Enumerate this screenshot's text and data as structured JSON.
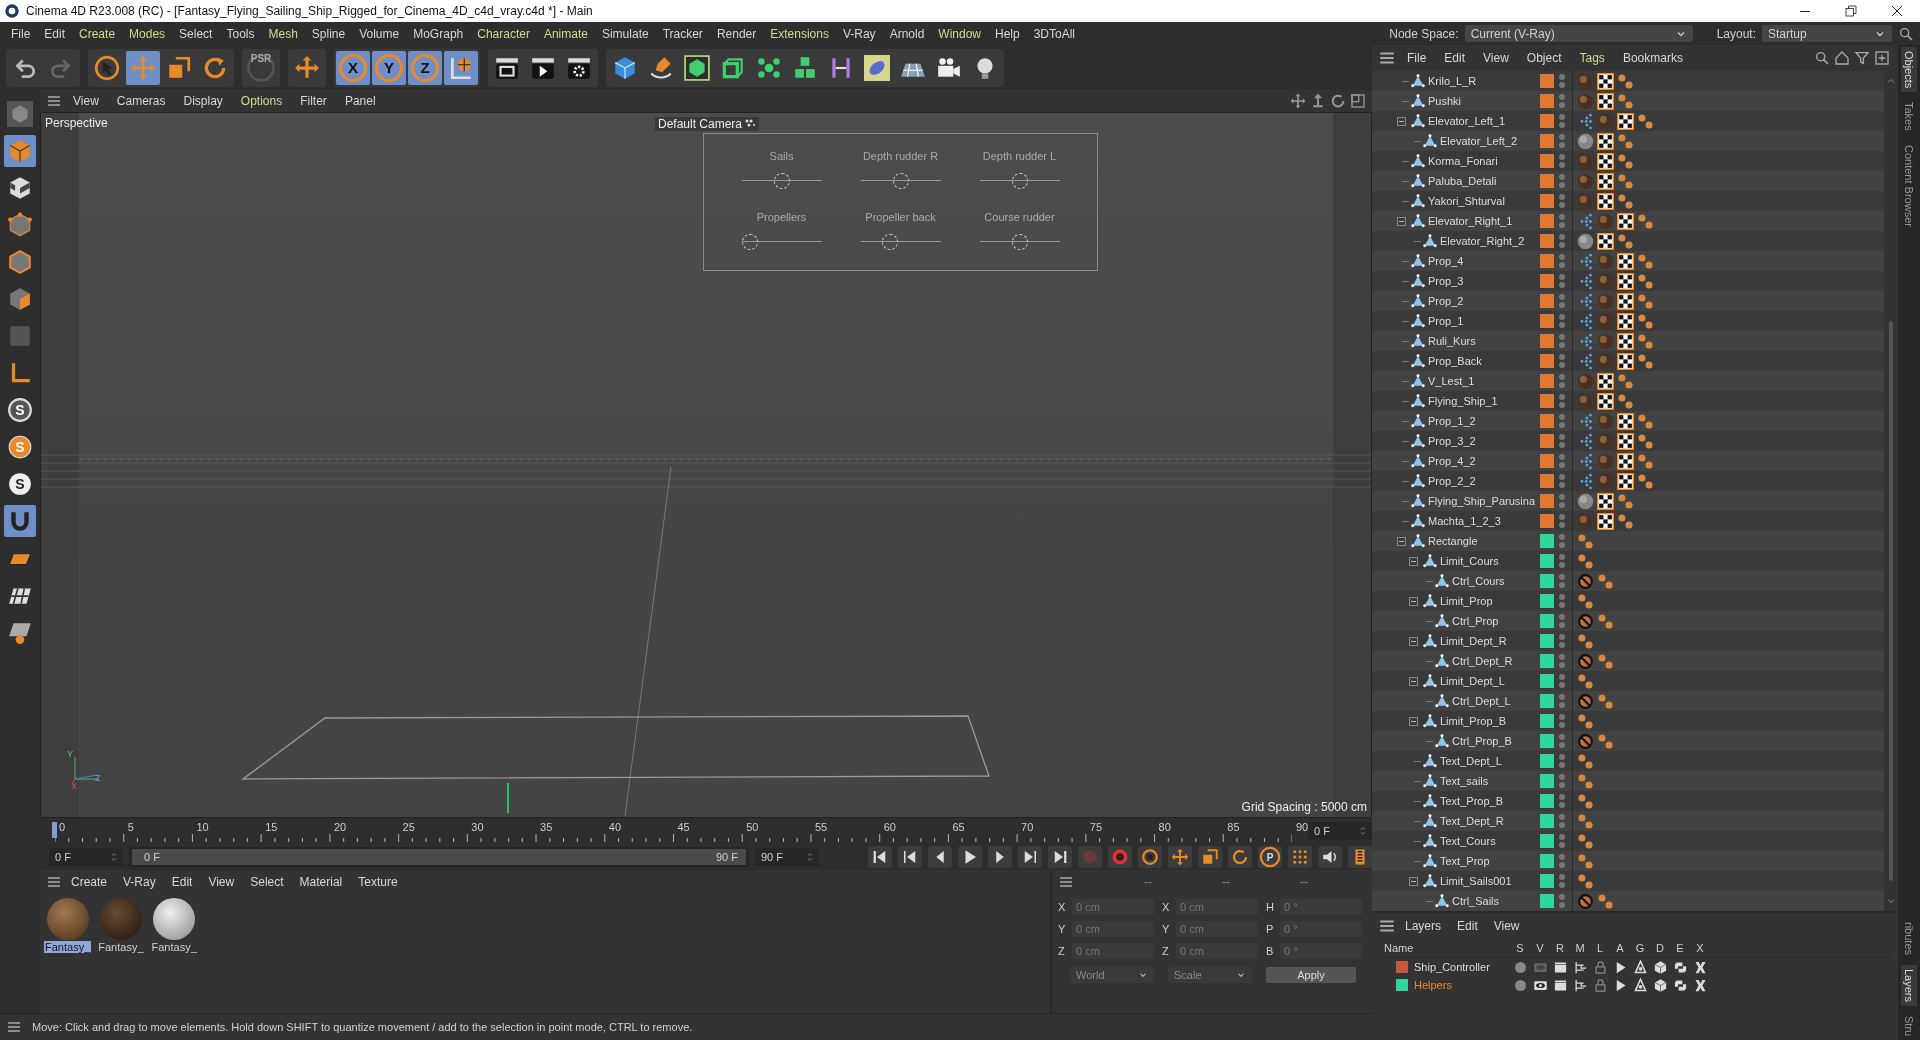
{
  "window": {
    "title": "Cinema 4D R23.008 (RC) - [Fantasy_Flying_Sailing_Ship_Rigged_for_Cinema_4D_c4d_vray.c4d *] - Main"
  },
  "menu_bar": [
    {
      "label": "File",
      "highlighted": false
    },
    {
      "label": "Edit",
      "highlighted": false
    },
    {
      "label": "Create",
      "highlighted": true
    },
    {
      "label": "Modes",
      "highlighted": true
    },
    {
      "label": "Select",
      "highlighted": false
    },
    {
      "label": "Tools",
      "highlighted": false
    },
    {
      "label": "Mesh",
      "highlighted": true
    },
    {
      "label": "Spline",
      "highlighted": false
    },
    {
      "label": "Volume",
      "highlighted": false
    },
    {
      "label": "MoGraph",
      "highlighted": false
    },
    {
      "label": "Character",
      "highlighted": true
    },
    {
      "label": "Animate",
      "highlighted": true
    },
    {
      "label": "Simulate",
      "highlighted": false
    },
    {
      "label": "Tracker",
      "highlighted": false
    },
    {
      "label": "Render",
      "highlighted": false
    },
    {
      "label": "Extensions",
      "highlighted": true
    },
    {
      "label": "V-Ray",
      "highlighted": false
    },
    {
      "label": "Arnold",
      "highlighted": false
    },
    {
      "label": "Window",
      "highlighted": true
    },
    {
      "label": "Help",
      "highlighted": false
    },
    {
      "label": "3DToAll",
      "highlighted": false
    }
  ],
  "node_space": {
    "label": "Node Space:",
    "value": "Current (V-Ray)"
  },
  "layout": {
    "label": "Layout:",
    "value": "Startup"
  },
  "toolbar": [
    {
      "items": [
        {
          "kind": "undo",
          "selected": false
        },
        {
          "kind": "redo",
          "selected": false
        }
      ]
    },
    {
      "items": [
        {
          "kind": "select",
          "selected": false
        },
        {
          "kind": "move",
          "selected": true
        },
        {
          "kind": "scale",
          "selected": false
        },
        {
          "kind": "rotate",
          "selected": false
        }
      ]
    },
    {
      "items": [
        {
          "kind": "psr",
          "label": "PSR",
          "selected": false
        }
      ]
    },
    {
      "items": [
        {
          "kind": "addmove",
          "selected": false
        }
      ]
    },
    {
      "items": [
        {
          "kind": "axis",
          "label": "X",
          "selected": true
        },
        {
          "kind": "axis",
          "label": "Y",
          "selected": true
        },
        {
          "kind": "axis",
          "label": "Z",
          "selected": true
        },
        {
          "kind": "world",
          "selected": true
        }
      ]
    },
    {
      "items": [
        {
          "kind": "renderview",
          "selected": false
        },
        {
          "kind": "render",
          "selected": false
        },
        {
          "kind": "rendersettings",
          "selected": false
        }
      ]
    },
    {
      "items": [
        {
          "kind": "cube",
          "selected": false
        },
        {
          "kind": "pen",
          "selected": false
        },
        {
          "kind": "subdiv",
          "selected": false
        },
        {
          "kind": "extrude",
          "selected": false
        },
        {
          "kind": "cloner",
          "selected": false
        },
        {
          "kind": "cubes",
          "selected": false
        },
        {
          "kind": "deformer",
          "selected": false
        },
        {
          "kind": "field",
          "selected": false
        },
        {
          "kind": "floor",
          "selected": false
        },
        {
          "kind": "camera",
          "selected": false
        },
        {
          "kind": "light",
          "selected": false
        }
      ]
    }
  ],
  "tool_palette": [
    {
      "kind": "editable",
      "selected": false
    },
    {
      "kind": "model",
      "selected": true
    },
    {
      "kind": "texture",
      "selected": false
    },
    {
      "kind": "points",
      "selected": false
    },
    {
      "kind": "edges",
      "selected": false
    },
    {
      "kind": "polygons",
      "selected": false
    },
    {
      "kind": "solo",
      "selected": false
    },
    {
      "kind": "axisl",
      "selected": false
    },
    {
      "kind": "snap",
      "label": "S",
      "selected": false
    },
    {
      "kind": "snapo",
      "label": "S",
      "selected": false
    },
    {
      "kind": "snapw",
      "label": "S",
      "selected": false
    },
    {
      "kind": "tweak",
      "selected": true
    },
    {
      "kind": "workplane",
      "selected": false
    },
    {
      "kind": "gridplane",
      "selected": false
    },
    {
      "kind": "lockplane",
      "selected": false
    }
  ],
  "viewport": {
    "menu": [
      {
        "label": "View",
        "highlighted": false
      },
      {
        "label": "Cameras",
        "highlighted": false
      },
      {
        "label": "Display",
        "highlighted": false
      },
      {
        "label": "Options",
        "highlighted": true
      },
      {
        "label": "Filter",
        "highlighted": false
      },
      {
        "label": "Panel",
        "highlighted": false
      }
    ],
    "name": "Perspective",
    "camera": "Default Camera",
    "controls": [
      {
        "label": "Sails",
        "level": 0.5
      },
      {
        "label": "Depth rudder R",
        "level": 0.5
      },
      {
        "label": "Depth rudder L",
        "level": 0.5
      },
      {
        "label": "Propellers",
        "level": 0
      },
      {
        "label": "Propeller back",
        "level": 0.33
      },
      {
        "label": "Course rudder",
        "level": 0.5
      }
    ],
    "axis_labels": [
      "Y",
      "X",
      "Z"
    ],
    "grid_spacing": "Grid Spacing : 5000 cm"
  },
  "timeline": {
    "ticks": [
      "0",
      "5",
      "10",
      "15",
      "20",
      "25",
      "30",
      "35",
      "40",
      "45",
      "50",
      "55",
      "60",
      "65",
      "70",
      "75",
      "80",
      "85",
      "90"
    ],
    "level": 0,
    "current": "0 F",
    "start": "0 F",
    "range": {
      "start": "0 F",
      "end": "90 F",
      "level": 1
    },
    "end": "90 F",
    "transport": [
      {
        "kind": "first"
      },
      {
        "kind": "prevkey"
      },
      {
        "kind": "prevframe"
      },
      {
        "kind": "play"
      },
      {
        "kind": "nextframe"
      },
      {
        "kind": "nextkey"
      },
      {
        "kind": "last"
      },
      {
        "kind": "recoff"
      },
      {
        "kind": "autokey"
      },
      {
        "kind": "key"
      },
      {
        "kind": "kmove"
      },
      {
        "kind": "kscale"
      },
      {
        "kind": "krot"
      },
      {
        "kind": "kparam",
        "label": "P"
      },
      {
        "kind": "kgrid"
      },
      {
        "kind": "sound"
      },
      {
        "kind": "script"
      }
    ]
  },
  "materials": {
    "menu": [
      "Create",
      "V-Ray",
      "Edit",
      "View",
      "Select",
      "Material",
      "Texture"
    ],
    "items": [
      {
        "name": "Fantasy_",
        "kind": "wood",
        "selected": true
      },
      {
        "name": "Fantasy_",
        "kind": "dark",
        "selected": false
      },
      {
        "name": "Fantasy_",
        "kind": "white",
        "selected": false
      }
    ]
  },
  "coordinates": {
    "headers": [
      "--",
      "--",
      "--"
    ],
    "rows": [
      {
        "axis": "X",
        "position": "0 cm",
        "size_axis": "X",
        "size": "0 cm",
        "rot_axis": "H",
        "rotation": "0 °"
      },
      {
        "axis": "Y",
        "position": "0 cm",
        "size_axis": "Y",
        "size": "0 cm",
        "rot_axis": "P",
        "rotation": "0 °"
      },
      {
        "axis": "Z",
        "position": "0 cm",
        "size_axis": "Z",
        "size": "0 cm",
        "rot_axis": "B",
        "rotation": "0 °"
      }
    ],
    "mode": "World",
    "size_mode": "Scale",
    "apply": "Apply"
  },
  "status_bar": "Move: Click and drag to move elements. Hold down SHIFT to quantize movement / add to the selection in point mode, CTRL to remove.",
  "object_manager": {
    "menu": [
      {
        "label": "File",
        "highlighted": false
      },
      {
        "label": "Edit",
        "highlighted": false
      },
      {
        "label": "View",
        "highlighted": false
      },
      {
        "label": "Object",
        "highlighted": false
      },
      {
        "label": "Tags",
        "highlighted": true
      },
      {
        "label": "Bookmarks",
        "highlighted": false
      }
    ],
    "objects": [
      {
        "name": "Krilo_L_R",
        "color": "#e07a33",
        "tags": [
          {
            "kind": "mdark"
          },
          {
            "kind": "uvw"
          },
          {
            "kind": "sel"
          }
        ]
      },
      {
        "name": "Pushki",
        "color": "#e07a33",
        "tags": [
          {
            "kind": "mdark"
          },
          {
            "kind": "uvw"
          },
          {
            "kind": "sel"
          }
        ]
      },
      {
        "name": "Elevator_Left_1",
        "color": "#e07a33",
        "tags": [
          {
            "kind": "vmap"
          },
          {
            "kind": "mdark"
          },
          {
            "kind": "uvw"
          },
          {
            "kind": "sel"
          }
        ],
        "expanded": true,
        "children": [
          {
            "name": "Elevator_Left_2",
            "color": "#e07a33",
            "tags": [
              {
                "kind": "mgrey"
              },
              {
                "kind": "uvw"
              },
              {
                "kind": "sel"
              }
            ]
          }
        ]
      },
      {
        "name": "Korma_Fonari",
        "color": "#e07a33",
        "tags": [
          {
            "kind": "mdark"
          },
          {
            "kind": "uvw"
          },
          {
            "kind": "sel"
          }
        ]
      },
      {
        "name": "Paluba_Detali",
        "color": "#e07a33",
        "tags": [
          {
            "kind": "mdark"
          },
          {
            "kind": "uvw"
          },
          {
            "kind": "sel"
          }
        ]
      },
      {
        "name": "Yakori_Shturval",
        "color": "#e07a33",
        "tags": [
          {
            "kind": "mdark"
          },
          {
            "kind": "uvw"
          },
          {
            "kind": "sel"
          }
        ]
      },
      {
        "name": "Elevator_Right_1",
        "color": "#e07a33",
        "tags": [
          {
            "kind": "vmap"
          },
          {
            "kind": "mdark"
          },
          {
            "kind": "uvw"
          },
          {
            "kind": "sel"
          }
        ],
        "expanded": true,
        "children": [
          {
            "name": "Elevator_Right_2",
            "color": "#e07a33",
            "tags": [
              {
                "kind": "mgrey"
              },
              {
                "kind": "uvw"
              },
              {
                "kind": "sel"
              }
            ]
          }
        ]
      },
      {
        "name": "Prop_4",
        "color": "#e07a33",
        "tags": [
          {
            "kind": "vmap"
          },
          {
            "kind": "mdark"
          },
          {
            "kind": "uvw"
          },
          {
            "kind": "sel"
          }
        ]
      },
      {
        "name": "Prop_3",
        "color": "#e07a33",
        "tags": [
          {
            "kind": "vmap"
          },
          {
            "kind": "mdark"
          },
          {
            "kind": "uvw"
          },
          {
            "kind": "sel"
          }
        ]
      },
      {
        "name": "Prop_2",
        "color": "#e07a33",
        "tags": [
          {
            "kind": "vmap"
          },
          {
            "kind": "mdark"
          },
          {
            "kind": "uvw"
          },
          {
            "kind": "sel"
          }
        ]
      },
      {
        "name": "Prop_1",
        "color": "#e07a33",
        "tags": [
          {
            "kind": "vmap"
          },
          {
            "kind": "mdark"
          },
          {
            "kind": "uvw"
          },
          {
            "kind": "sel"
          }
        ]
      },
      {
        "name": "Ruli_Kurs",
        "color": "#e07a33",
        "tags": [
          {
            "kind": "vmap"
          },
          {
            "kind": "mdark"
          },
          {
            "kind": "uvw"
          },
          {
            "kind": "sel"
          }
        ]
      },
      {
        "name": "Prop_Back",
        "color": "#e07a33",
        "tags": [
          {
            "kind": "vmap"
          },
          {
            "kind": "mdark"
          },
          {
            "kind": "uvw"
          },
          {
            "kind": "sel"
          }
        ]
      },
      {
        "name": "V_Lest_1",
        "color": "#e07a33",
        "tags": [
          {
            "kind": "mdark"
          },
          {
            "kind": "uvw"
          },
          {
            "kind": "sel"
          }
        ]
      },
      {
        "name": "Flying_Ship_1",
        "color": "#e07a33",
        "tags": [
          {
            "kind": "mdark"
          },
          {
            "kind": "uvw"
          },
          {
            "kind": "sel"
          }
        ]
      },
      {
        "name": "Prop_1_2",
        "color": "#e07a33",
        "tags": [
          {
            "kind": "vmap"
          },
          {
            "kind": "mdark"
          },
          {
            "kind": "uvw"
          },
          {
            "kind": "sel"
          }
        ]
      },
      {
        "name": "Prop_3_2",
        "color": "#e07a33",
        "tags": [
          {
            "kind": "vmap"
          },
          {
            "kind": "mdark"
          },
          {
            "kind": "uvw"
          },
          {
            "kind": "sel"
          }
        ]
      },
      {
        "name": "Prop_4_2",
        "color": "#e07a33",
        "tags": [
          {
            "kind": "vmap"
          },
          {
            "kind": "mdark"
          },
          {
            "kind": "uvw"
          },
          {
            "kind": "sel"
          }
        ]
      },
      {
        "name": "Prop_2_2",
        "color": "#e07a33",
        "tags": [
          {
            "kind": "vmap"
          },
          {
            "kind": "mdark"
          },
          {
            "kind": "uvw"
          },
          {
            "kind": "sel"
          }
        ]
      },
      {
        "name": "Flying_Ship_Parusina",
        "color": "#e07a33",
        "tags": [
          {
            "kind": "mgrey"
          },
          {
            "kind": "uvw"
          },
          {
            "kind": "sel"
          }
        ]
      },
      {
        "name": "Machta_1_2_3",
        "color": "#e07a33",
        "tags": [
          {
            "kind": "mdark"
          },
          {
            "kind": "uvw"
          },
          {
            "kind": "sel"
          }
        ]
      },
      {
        "name": "Rectangle",
        "color": "#2fd89a",
        "tags": [
          {
            "kind": "sel"
          }
        ],
        "expanded": true,
        "children": [
          {
            "name": "Limit_Cours",
            "color": "#2fd89a",
            "tags": [
              {
                "kind": "sel"
              }
            ],
            "expanded": true,
            "children": [
              {
                "name": "Ctrl_Cours",
                "color": "#2fd89a",
                "tags": [
                  {
                    "kind": "prot"
                  },
                  {
                    "kind": "sel"
                  }
                ]
              }
            ]
          },
          {
            "name": "Limit_Prop",
            "color": "#2fd89a",
            "tags": [
              {
                "kind": "sel"
              }
            ],
            "expanded": true,
            "children": [
              {
                "name": "Ctrl_Prop",
                "color": "#2fd89a",
                "tags": [
                  {
                    "kind": "prot"
                  },
                  {
                    "kind": "sel"
                  }
                ]
              }
            ]
          },
          {
            "name": "Limit_Dept_R",
            "color": "#2fd89a",
            "tags": [
              {
                "kind": "sel"
              }
            ],
            "expanded": true,
            "children": [
              {
                "name": "Ctrl_Dept_R",
                "color": "#2fd89a",
                "tags": [
                  {
                    "kind": "prot"
                  },
                  {
                    "kind": "sel"
                  }
                ]
              }
            ]
          },
          {
            "name": "Limit_Dept_L",
            "color": "#2fd89a",
            "tags": [
              {
                "kind": "sel"
              }
            ],
            "expanded": true,
            "children": [
              {
                "name": "Ctrl_Dept_L",
                "color": "#2fd89a",
                "tags": [
                  {
                    "kind": "prot"
                  },
                  {
                    "kind": "sel"
                  }
                ]
              }
            ]
          },
          {
            "name": "Limit_Prop_B",
            "color": "#2fd89a",
            "tags": [
              {
                "kind": "sel"
              }
            ],
            "expanded": true,
            "children": [
              {
                "name": "Ctrl_Prop_B",
                "color": "#2fd89a",
                "tags": [
                  {
                    "kind": "prot"
                  },
                  {
                    "kind": "sel"
                  }
                ]
              }
            ]
          },
          {
            "name": "Text_Dept_L",
            "color": "#2fd89a",
            "tags": [
              {
                "kind": "sel"
              }
            ]
          },
          {
            "name": "Text_sails",
            "color": "#2fd89a",
            "tags": [
              {
                "kind": "sel"
              }
            ]
          },
          {
            "name": "Text_Prop_B",
            "color": "#2fd89a",
            "tags": [
              {
                "kind": "sel"
              }
            ]
          },
          {
            "name": "Text_Dept_R",
            "color": "#2fd89a",
            "tags": [
              {
                "kind": "sel"
              }
            ]
          },
          {
            "name": "Text_Cours",
            "color": "#2fd89a",
            "tags": [
              {
                "kind": "sel"
              }
            ]
          },
          {
            "name": "Text_Prop",
            "color": "#2fd89a",
            "tags": [
              {
                "kind": "sel"
              }
            ]
          },
          {
            "name": "Limit_Sails001",
            "color": "#2fd89a",
            "tags": [
              {
                "kind": "sel"
              }
            ],
            "expanded": true,
            "children": [
              {
                "name": "Ctrl_Sails",
                "color": "#2fd89a",
                "tags": [
                  {
                    "kind": "prot"
                  },
                  {
                    "kind": "sel"
                  }
                ]
              }
            ]
          }
        ]
      }
    ]
  },
  "layers": {
    "menu": [
      "Layers",
      "Edit",
      "View"
    ],
    "columns": [
      "Name",
      "S",
      "V",
      "R",
      "M",
      "L",
      "A",
      "G",
      "D",
      "E",
      "X"
    ],
    "rows": [
      {
        "name": "Ship_Controller",
        "color": "#c8583c",
        "selected": false,
        "visible": false
      },
      {
        "name": "Helpers",
        "color": "#2fd89a",
        "selected": true,
        "visible": true
      }
    ]
  },
  "side_tabs": [
    {
      "label": "Objects",
      "selected": true
    },
    {
      "label": "Takes",
      "selected": false
    },
    {
      "label": "Content Browser",
      "selected": false
    },
    {
      "label": "ributes",
      "selected": false
    },
    {
      "label": "Layers",
      "selected": true
    },
    {
      "label": "Stru",
      "selected": false
    }
  ]
}
